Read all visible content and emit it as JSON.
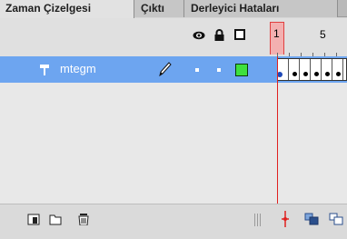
{
  "tabs": [
    {
      "label": "Zaman Çizelgesi",
      "active": true
    },
    {
      "label": "Çıktı",
      "active": false
    },
    {
      "label": "Derleyici Hataları",
      "active": false
    }
  ],
  "header": {
    "current_frame": "1",
    "frame_label_5": "5",
    "icons": [
      "eye-icon",
      "lock-icon",
      "outline-icon"
    ]
  },
  "layers": [
    {
      "name": "mtegm",
      "selected": true,
      "outline_color": "#3ee03e",
      "edit_icon": "pencil-icon"
    }
  ],
  "frames": {
    "count": 6,
    "keyframes_filled": [
      2,
      3,
      4,
      5,
      6
    ],
    "first_frame_key": true
  },
  "colors": {
    "selected_row": "#6da5f0",
    "playhead": "#e0211f",
    "outline_color": "#3ee03e"
  },
  "bottom_icons": [
    "new-layer-icon",
    "new-folder-icon",
    "delete-icon",
    "center-frame-icon",
    "onion-skin-icon",
    "onion-outline-icon"
  ]
}
